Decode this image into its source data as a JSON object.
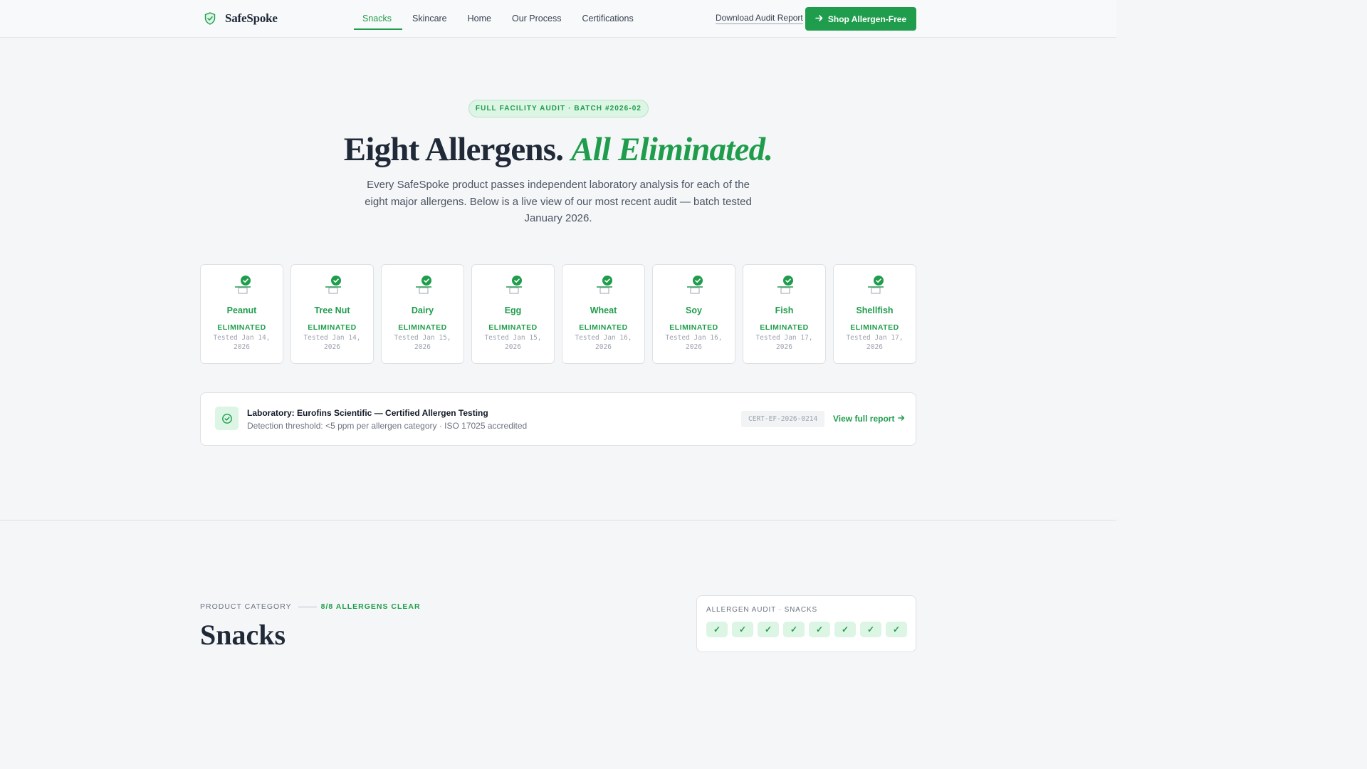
{
  "brand": {
    "name": "SafeSpoke",
    "icon": "shield-icon"
  },
  "nav": {
    "links": [
      {
        "label": "Snacks",
        "active": true
      },
      {
        "label": "Skincare"
      },
      {
        "label": "Home"
      },
      {
        "label": "Our Process"
      },
      {
        "label": "Certifications"
      }
    ],
    "download_label": "Download Audit Report",
    "shop_label": "Shop Allergen-Free",
    "shop_icon": "arrow-right-icon"
  },
  "hero": {
    "badge": "FULL FACILITY AUDIT · BATCH #2026-02",
    "title_main": "Eight Allergens.",
    "title_accent": "All Eliminated.",
    "subtitle": "Every SafeSpoke product passes independent laboratory analysis for each of the eight major allergens. Below is a live view of our most recent audit — batch tested January 2026."
  },
  "allergens": [
    {
      "name": "Peanut",
      "status": "ELIMINATED",
      "date": "Tested Jan 14, 2026"
    },
    {
      "name": "Tree Nut",
      "status": "ELIMINATED",
      "date": "Tested Jan 14, 2026"
    },
    {
      "name": "Dairy",
      "status": "ELIMINATED",
      "date": "Tested Jan 15, 2026"
    },
    {
      "name": "Egg",
      "status": "ELIMINATED",
      "date": "Tested Jan 15, 2026"
    },
    {
      "name": "Wheat",
      "status": "ELIMINATED",
      "date": "Tested Jan 16, 2026"
    },
    {
      "name": "Soy",
      "status": "ELIMINATED",
      "date": "Tested Jan 16, 2026"
    },
    {
      "name": "Fish",
      "status": "ELIMINATED",
      "date": "Tested Jan 17, 2026"
    },
    {
      "name": "Shellfish",
      "status": "ELIMINATED",
      "date": "Tested Jan 17, 2026"
    }
  ],
  "lab": {
    "title": "Laboratory: Eurofins Scientific — Certified Allergen Testing",
    "subtitle": "Detection threshold: <5 ppm per allergen category · ISO 17025 accredited",
    "cert_code": "CERT-EF-2026-0214",
    "view_label": "View full report",
    "icon": "badge-check-icon"
  },
  "product_section": {
    "label": "PRODUCT CATEGORY",
    "clear_label": "8/8 ALLERGENS CLEAR",
    "heading": "Snacks",
    "audit_panel_title": "ALLERGEN AUDIT · SNACKS",
    "audit_checks": [
      "✓",
      "✓",
      "✓",
      "✓",
      "✓",
      "✓",
      "✓",
      "✓"
    ]
  },
  "colors": {
    "accent": "#1f9d4c",
    "accent_soft": "#dcf5e4",
    "text": "#1f2937",
    "muted": "#6b7280",
    "background": "#f5f6f8"
  }
}
